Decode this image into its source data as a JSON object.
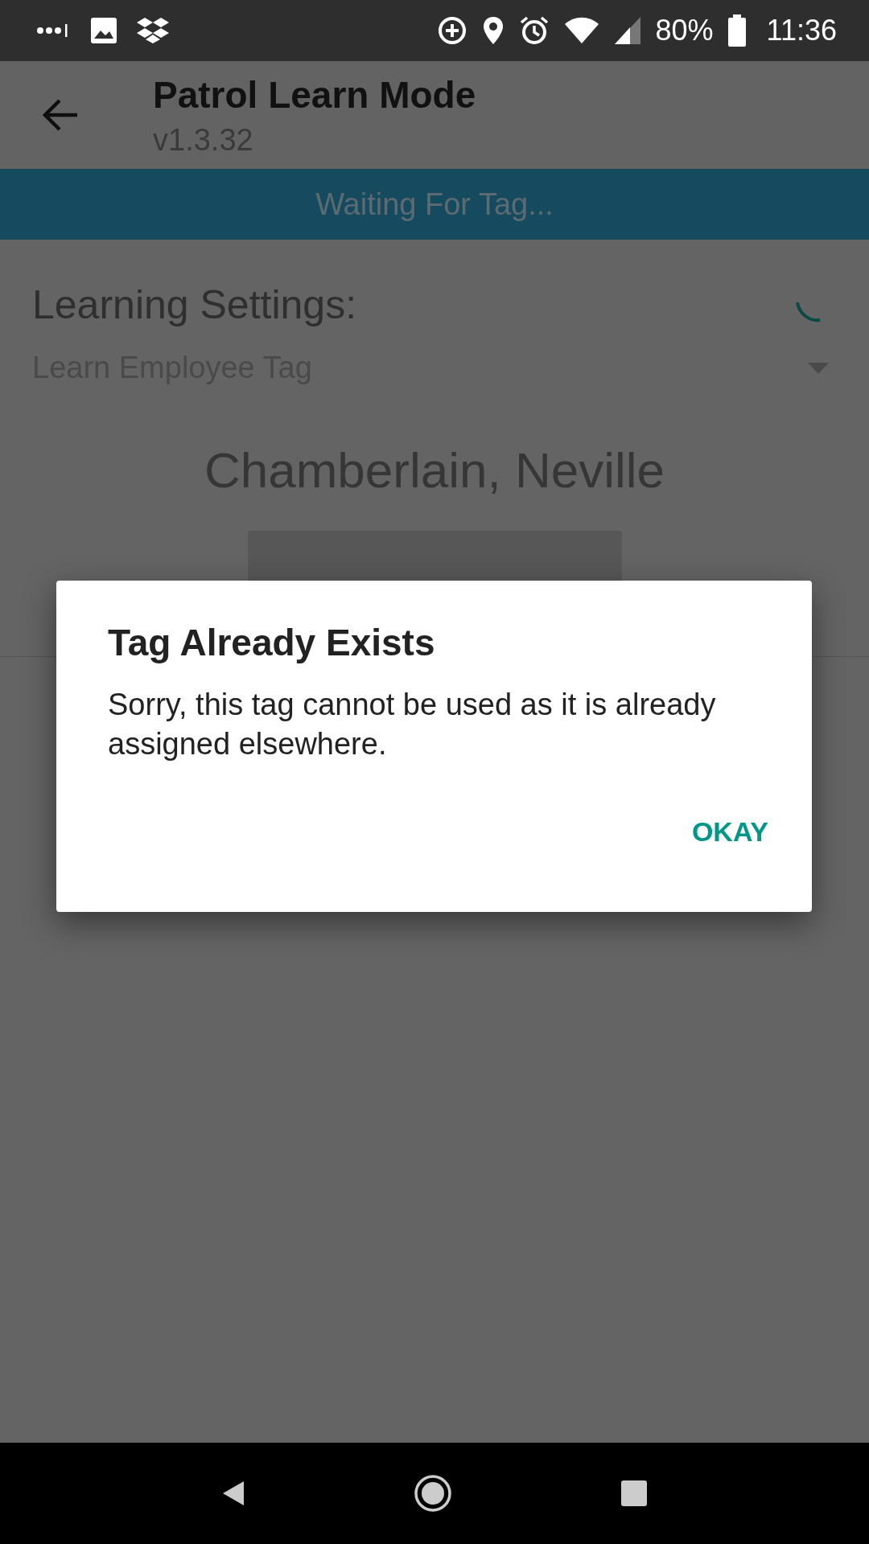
{
  "status_bar": {
    "battery": "80%",
    "time": "11:36"
  },
  "app_bar": {
    "title": "Patrol Learn Mode",
    "subtitle": "v1.3.32"
  },
  "banner": "Waiting For Tag...",
  "learning_settings": {
    "label": "Learning Settings:",
    "dropdown": {
      "value": "Learn Employee Tag"
    }
  },
  "employee_name": "Chamberlain, Neville",
  "dialog": {
    "title": "Tag Already Exists",
    "message": "Sorry, this tag cannot be used as it is already assigned elsewhere.",
    "buttons": [
      "OKAY"
    ]
  }
}
